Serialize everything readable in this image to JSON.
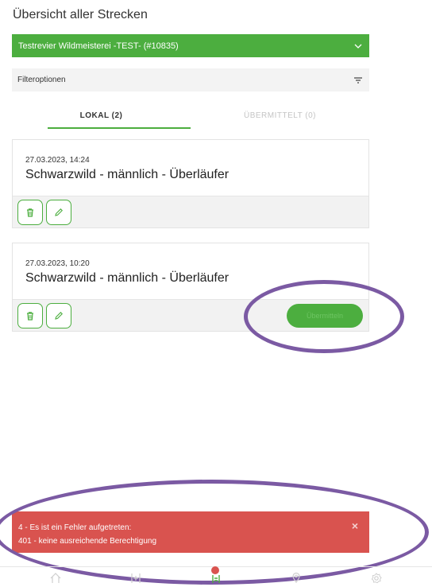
{
  "header": {
    "title": "Übersicht aller Strecken"
  },
  "revier": {
    "selected": "Testrevier Wildmeisterei -TEST- (#10835)"
  },
  "filter": {
    "label": "Filteroptionen"
  },
  "tabs": [
    {
      "label": "LOKAL (2)",
      "active": true
    },
    {
      "label": "ÜBERMITTELT (0)",
      "active": false
    }
  ],
  "entries": [
    {
      "date": "27.03.2023, 14:24",
      "title": "Schwarzwild - männlich - Überläufer"
    },
    {
      "date": "27.03.2023, 10:20",
      "title": "Schwarzwild - männlich - Überläufer",
      "submit_label": "Übermitteln"
    }
  ],
  "toast": {
    "line1": "4 - Es ist ein Fehler aufgetreten:",
    "line2": "401 - keine ausreichende Berechtigung",
    "close": "×"
  },
  "nav": {
    "items": [
      "home-icon",
      "add-icon",
      "list-icon",
      "map-pin-icon",
      "settings-icon"
    ]
  },
  "colors": {
    "accent": "#4cae3f",
    "error": "#d9534f",
    "annotation": "#7b5aa3"
  }
}
